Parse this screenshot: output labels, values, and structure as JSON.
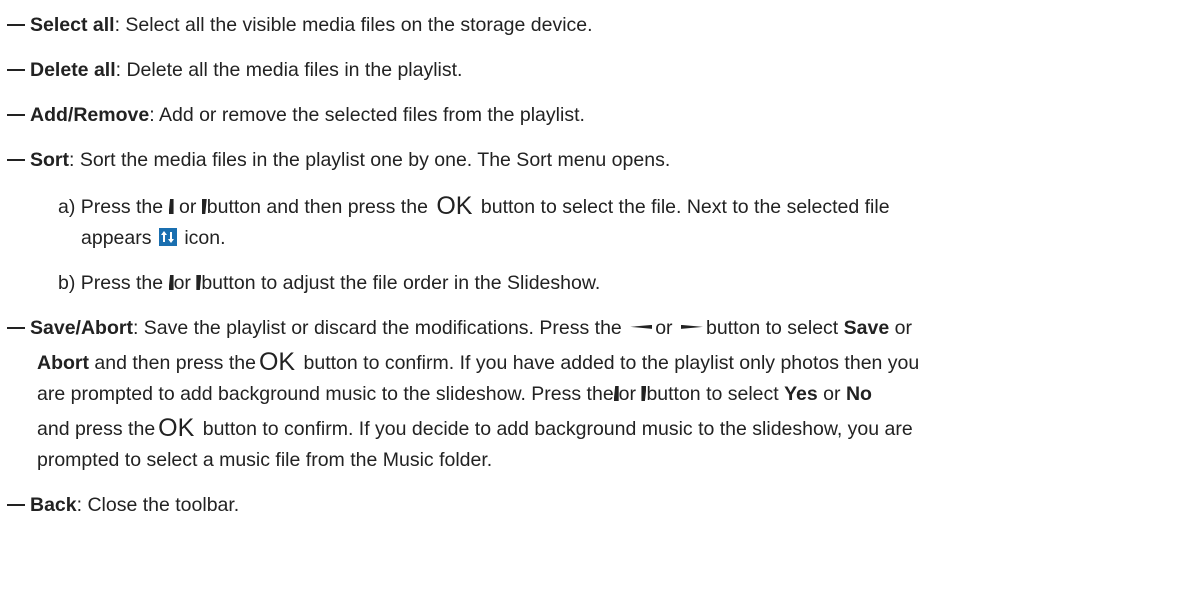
{
  "items": [
    {
      "term": "Select all",
      "desc": ": Select all the visible media files on the storage device."
    },
    {
      "term": "Delete all",
      "desc": ": Delete all the media files in the playlist."
    },
    {
      "term": "Add/Remove",
      "desc": ": Add or remove the selected files from the playlist."
    },
    {
      "term": "Sort",
      "desc": ": Sort the media files in the playlist one by one. The Sort menu opens."
    },
    {
      "term": "Save/Abort",
      "desc": ": Save the playlist or discard the modifications. Press the"
    },
    {
      "term": "Back",
      "desc": ": Close the toolbar."
    }
  ],
  "sort_steps": {
    "a_pre": "a) Press the",
    "a_or": "or",
    "a_mid": "button and then press the",
    "a_ok": "OK",
    "a_post": "button to select the file. Next to the selected file",
    "a_line2_pre": "appears",
    "a_line2_post": "icon.",
    "b_pre": "b) Press the",
    "b_or": "or",
    "b_post": "button to adjust the file order in the Slideshow."
  },
  "save_abort": {
    "l1_or": "or",
    "l1_post": "button to select",
    "l1_save": "Save",
    "l1_or2": "or",
    "l2_abort": "Abort",
    "l2_pre": "and then press the",
    "l2_ok": "OK",
    "l2_post": "button to confirm. If you have added to the playlist only photos then you",
    "l3_pre": "are prompted to add background music to the slideshow. Press the",
    "l3_or": "or",
    "l3_mid": "button to select",
    "l3_yes": "Yes",
    "l3_or2": "or",
    "l3_no": "No",
    "l4_pre": "and press the",
    "l4_ok": "OK",
    "l4_post": "button to confirm. If you decide to add background music to the slideshow, you are",
    "l5": "prompted to select a music file from the Music folder."
  },
  "icons": {
    "up": "up-button-icon",
    "down": "down-button-icon",
    "left": "left-button-icon",
    "right": "right-button-icon",
    "sort": "sort-order-icon",
    "sort_color": "#1a6fb0"
  }
}
